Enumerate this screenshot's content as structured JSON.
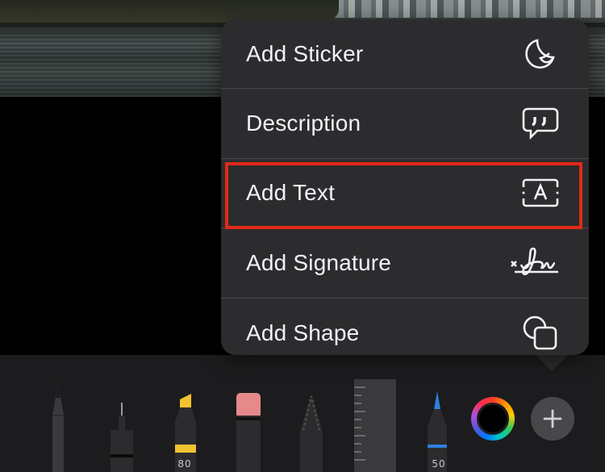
{
  "menu": {
    "items": [
      {
        "label": "Add Sticker",
        "icon": "sticker-icon"
      },
      {
        "label": "Description",
        "icon": "quote-bubble-icon"
      },
      {
        "label": "Add Text",
        "icon": "text-box-icon"
      },
      {
        "label": "Add Signature",
        "icon": "signature-icon"
      },
      {
        "label": "Add Shape",
        "icon": "shapes-icon"
      }
    ],
    "highlighted_item": "Add Text",
    "highlight_color": "#e02a18"
  },
  "toolbar": {
    "marker_width": "80",
    "pen_width": "50",
    "marker_color": "#f2c230",
    "pen_color": "#2f7fe0",
    "eraser_color": "#e5898a"
  }
}
